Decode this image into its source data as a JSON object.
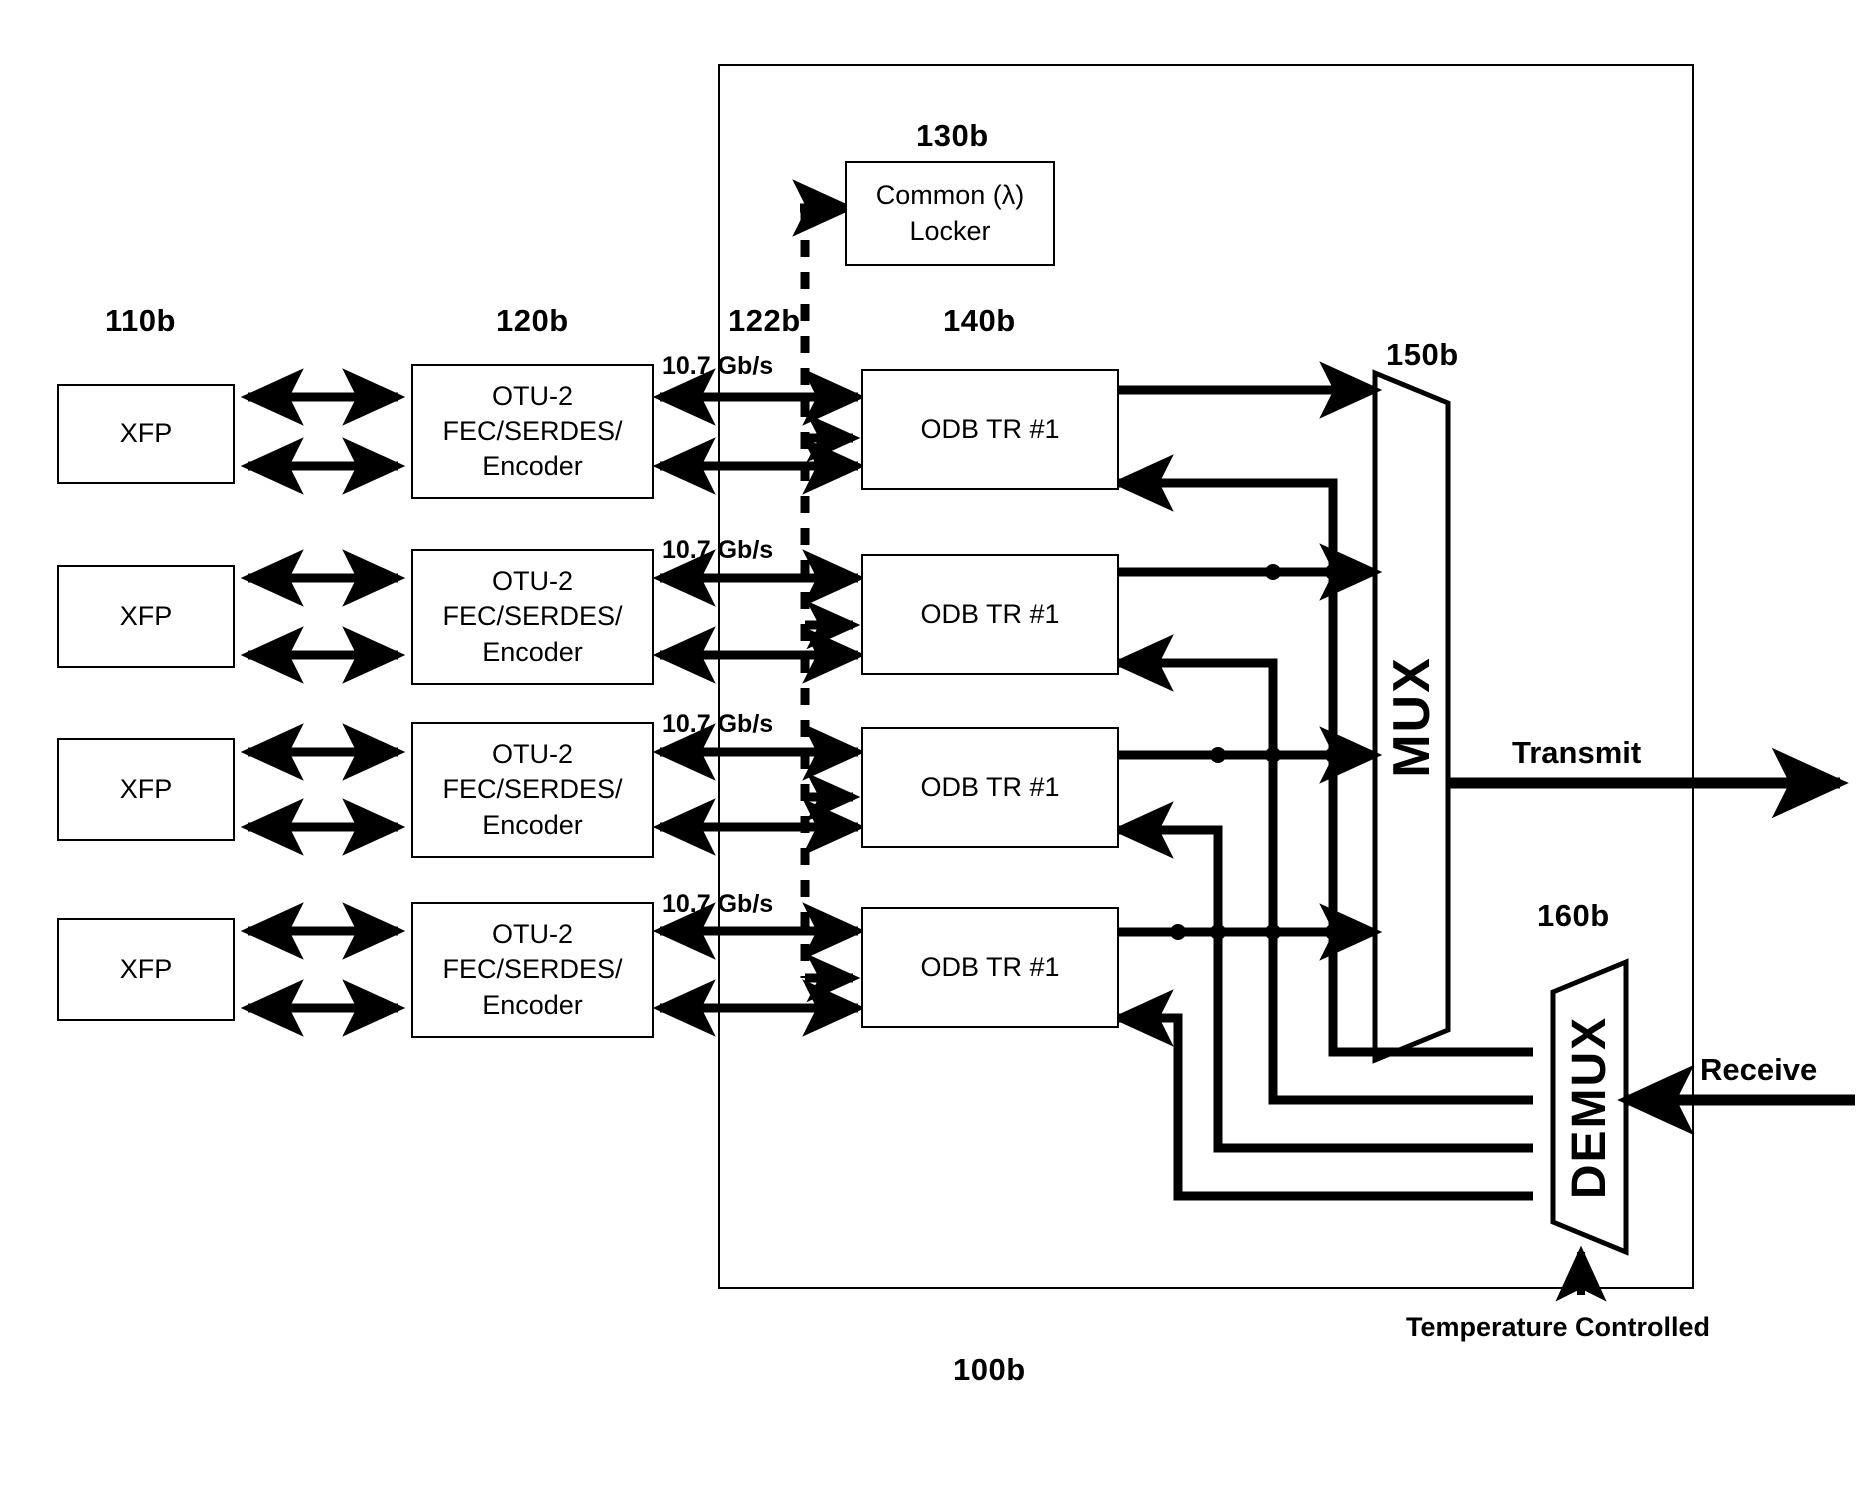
{
  "figure": {
    "system_label": "100b",
    "temperature_note": "Temperature Controlled"
  },
  "refs": {
    "xfp_group": "110b",
    "otu_group": "120b",
    "interface_group": "122b",
    "locker": "130b",
    "odb_group": "140b",
    "mux": "150b",
    "demux": "160b"
  },
  "locker": {
    "line1": "Common (λ)",
    "line2": "Locker"
  },
  "mux": {
    "label": "MUX"
  },
  "demux": {
    "label": "DEMUX"
  },
  "flows": {
    "transmit": "Transmit",
    "receive": "Receive"
  },
  "channels": [
    {
      "xfp": "XFP",
      "otu_line1": "OTU-2",
      "otu_line2": "FEC/SERDES/",
      "otu_line3": "Encoder",
      "rate": "10.7 Gb/s",
      "odb": "ODB TR #1"
    },
    {
      "xfp": "XFP",
      "otu_line1": "OTU-2",
      "otu_line2": "FEC/SERDES/",
      "otu_line3": "Encoder",
      "rate": "10.7 Gb/s",
      "odb": "ODB TR #1"
    },
    {
      "xfp": "XFP",
      "otu_line1": "OTU-2",
      "otu_line2": "FEC/SERDES/",
      "otu_line3": "Encoder",
      "rate": "10.7 Gb/s",
      "odb": "ODB TR #1"
    },
    {
      "xfp": "XFP",
      "otu_line1": "OTU-2",
      "otu_line2": "FEC/SERDES/",
      "otu_line3": "Encoder",
      "rate": "10.7 Gb/s",
      "odb": "ODB TR #1"
    }
  ],
  "colors": {
    "line": "#000000",
    "background": "#ffffff"
  }
}
